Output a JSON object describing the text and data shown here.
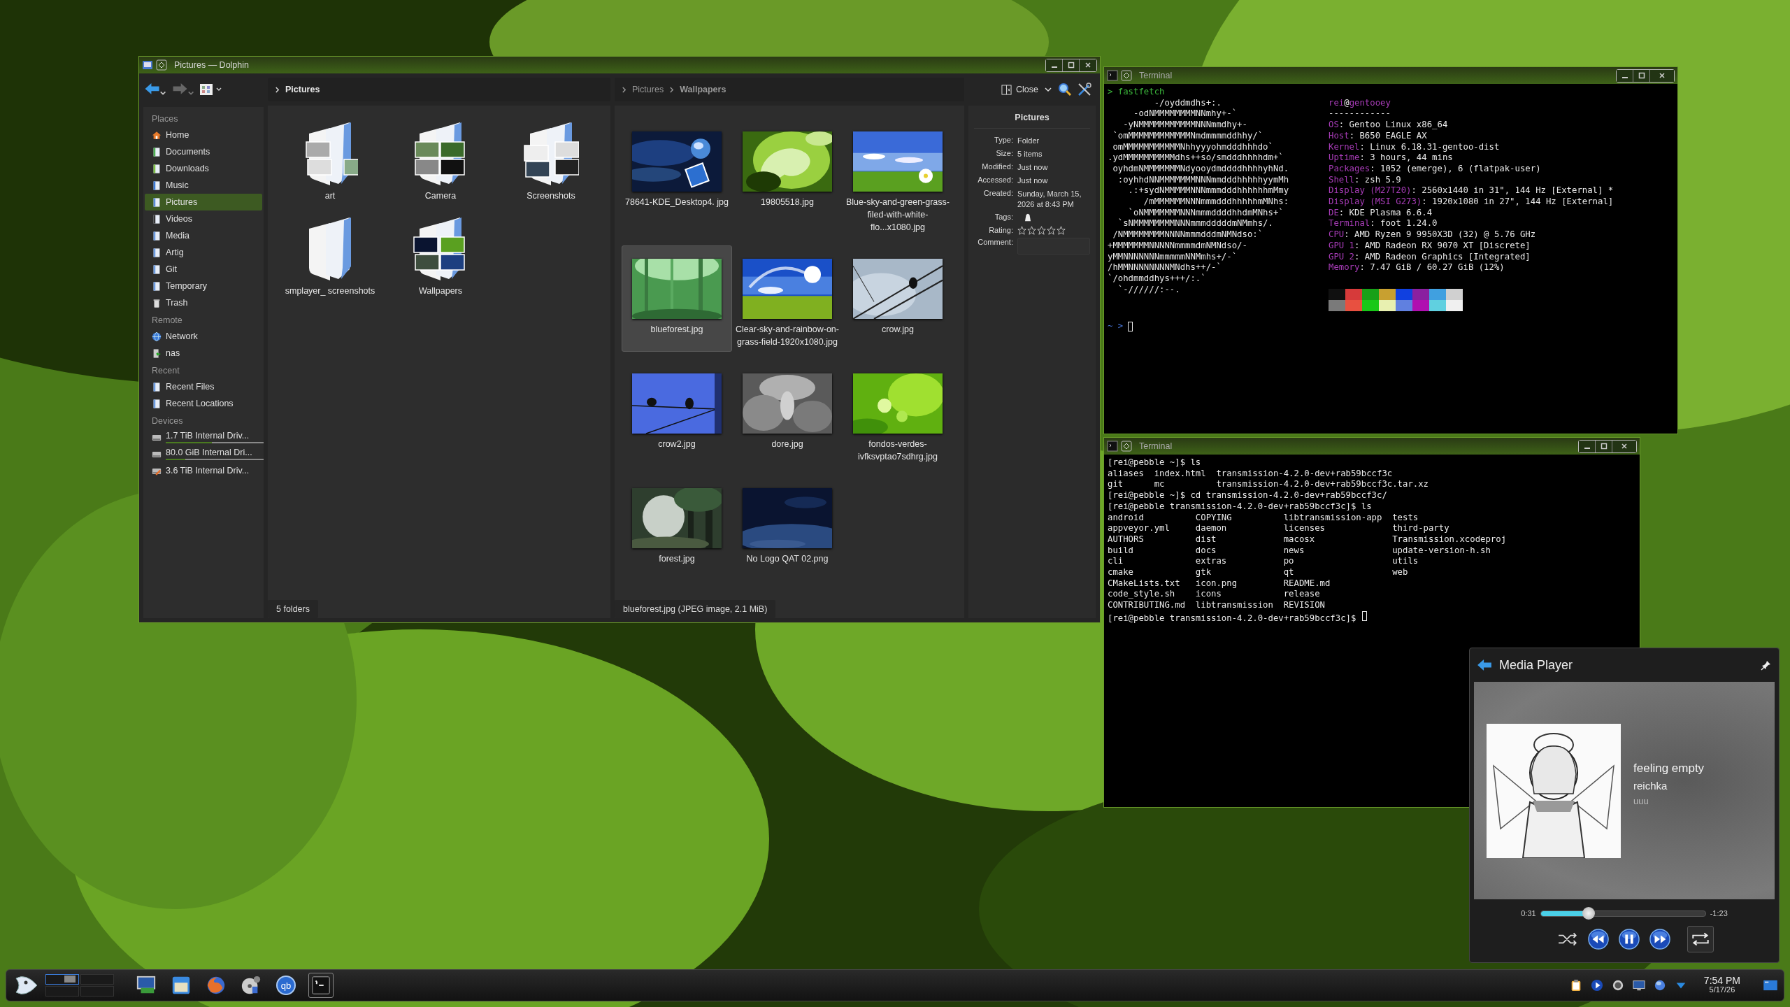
{
  "dolphin": {
    "title": "Pictures — Dolphin",
    "places": [
      {
        "heading": "Places",
        "items": [
          {
            "label": "Home",
            "kind": "home",
            "selected": false
          },
          {
            "label": "Documents",
            "kind": "documents",
            "selected": false
          },
          {
            "label": "Downloads",
            "kind": "downloads",
            "selected": false
          },
          {
            "label": "Music",
            "kind": "music",
            "selected": false
          },
          {
            "label": "Pictures",
            "kind": "pictures",
            "selected": true
          },
          {
            "label": "Videos",
            "kind": "videos",
            "selected": false
          },
          {
            "label": "Media",
            "kind": "folder",
            "selected": false
          },
          {
            "label": "Artig",
            "kind": "folder",
            "selected": false
          },
          {
            "label": "Git",
            "kind": "folder",
            "selected": false
          },
          {
            "label": "Temporary",
            "kind": "folder",
            "selected": false
          },
          {
            "label": "Trash",
            "kind": "trash",
            "selected": false
          }
        ]
      },
      {
        "heading": "Remote",
        "items": [
          {
            "label": "Network",
            "kind": "network",
            "selected": false
          },
          {
            "label": "nas",
            "kind": "nas",
            "selected": false
          }
        ]
      },
      {
        "heading": "Recent",
        "items": [
          {
            "label": "Recent Files",
            "kind": "folder",
            "selected": false
          },
          {
            "label": "Recent Locations",
            "kind": "folder",
            "selected": false
          }
        ]
      },
      {
        "heading": "Devices",
        "items": [
          {
            "label": "1.7 TiB Internal Driv...",
            "kind": "drive",
            "selected": false,
            "level": 0.47
          },
          {
            "label": "80.0 GiB Internal Dri...",
            "kind": "drive",
            "selected": false,
            "level": 0.2
          },
          {
            "label": "3.6 TiB Internal Driv...",
            "kind": "drive-alt",
            "selected": false
          }
        ]
      }
    ],
    "left_view": {
      "breadcrumb": [
        "Pictures"
      ],
      "items": [
        {
          "label": "art"
        },
        {
          "label": "Camera"
        },
        {
          "label": "Screenshots"
        },
        {
          "label": "smplayer_ screenshots"
        },
        {
          "label": "Wallpapers"
        }
      ],
      "status": "5 folders"
    },
    "right_view": {
      "breadcrumb": [
        "Pictures",
        "Wallpapers"
      ],
      "items": [
        {
          "label": "78641-KDE_Desktop4. jpg",
          "selected": false
        },
        {
          "label": "19805518.jpg",
          "selected": false
        },
        {
          "label": "Blue-sky-and-green-grass-filed-with-white-flo...x1080.jpg",
          "selected": false
        },
        {
          "label": "blueforest.jpg",
          "selected": true
        },
        {
          "label": "Clear-sky-and-rainbow-on-grass-field-1920x1080.jpg",
          "selected": false
        },
        {
          "label": "crow.jpg",
          "selected": false
        },
        {
          "label": "crow2.jpg",
          "selected": false
        },
        {
          "label": "dore.jpg",
          "selected": false
        },
        {
          "label": "fondos-verdes-ivfksvptao7sdhrg.jpg",
          "selected": false
        },
        {
          "label": "forest.jpg",
          "selected": false
        },
        {
          "label": "No Logo QAT 02.png",
          "selected": false
        }
      ],
      "status": "blueforest.jpg (JPEG image, 2.1 MiB)"
    },
    "close_button": "Close",
    "info": {
      "title": "Pictures",
      "fields": [
        {
          "key": "Type:",
          "value": "Folder"
        },
        {
          "key": "Size:",
          "value": "5 items"
        },
        {
          "key": "Modified:",
          "value": "Just now"
        },
        {
          "key": "Accessed:",
          "value": "Just now"
        },
        {
          "key": "Created:",
          "value": "Sunday, March 15, 2026 at 8:43 PM"
        }
      ],
      "tags_label": "Tags:",
      "rating_label": "Rating:",
      "stars": 0,
      "comment_label": "Comment:"
    }
  },
  "terminal_1": {
    "title": "Terminal",
    "command": "> fastfetch",
    "logo": [
      "         -/oyddmdhs+:.",
      "     -odNMMMMMMMMNNmhy+-`",
      "   -yNMMMMMMMMMMMNNNmmdhy+-",
      " `omMMMMMMMMMMMMNmdmmmmddhhy/`",
      " omMMMMMMMMMMMNhhyyyohmdddhhhdo`",
      ".ydMMMMMMMMMMdhs++so/smdddhhhhdm+`",
      " oyhdmNMMMMMMMNdyooydmddddhhhhyhNd.",
      "  :oyhhdNNMMMMMMMNNNmmdddhhhhhyymMh",
      "    .:+sydNMMMMMNNNmmmdddhhhhhhmMmy",
      "       /mMMMMMMNNNmmmdddhhhhhmMNhs:",
      "    `oNMMMMMMMNNNmmmddddhhdmMNhs+`",
      "  `sNMMMMMMMMNNNmmmdddddmNMmhs/.",
      " /NMMMMMMMMNNNNmmmdddmNMNdso:`",
      "+MMMMMMMNNNNNmmmmdmNMNdso/-",
      "yMMNNNNNNNmmmmmNNMmhs+/-`",
      "/hMMNNNNNNNNMNdhs++/-`",
      "`/ohdmmddhys+++/:.`",
      "  `-//////:--."
    ],
    "user": "rei",
    "separator": "@",
    "host": "gentooey",
    "rule": "------------",
    "fields": [
      {
        "key": "OS",
        "value": ": Gentoo Linux x86_64"
      },
      {
        "key": "Host",
        "value": ": B650 EAGLE AX"
      },
      {
        "key": "Kernel",
        "value": ": Linux 6.18.31-gentoo-dist"
      },
      {
        "key": "Uptime",
        "value": ": 3 hours, 44 mins"
      },
      {
        "key": "Packages",
        "value": ": 1052 (emerge), 6 (flatpak-user)"
      },
      {
        "key": "Shell",
        "value": ": zsh 5.9"
      },
      {
        "key": "Display (M27T20)",
        "value": ": 2560x1440 in 31\", 144 Hz [External] *"
      },
      {
        "key": "Display (MSI G273)",
        "value": ": 1920x1080 in 27\", 144 Hz [External]"
      },
      {
        "key": "DE",
        "value": ": KDE Plasma 6.6.4"
      },
      {
        "key": "Terminal",
        "value": ": foot 1.24.0"
      },
      {
        "key": "CPU",
        "value": ": AMD Ryzen 9 9950X3D (32) @ 5.76 GHz"
      },
      {
        "key": "GPU 1",
        "value": ": AMD Radeon RX 9070 XT [Discrete]"
      },
      {
        "key": "GPU 2",
        "value": ": AMD Radeon Graphics [Integrated]"
      },
      {
        "key": "Memory",
        "value": ": 7.47 GiB / 60.27 GiB (12%)"
      }
    ],
    "palette": [
      {
        "color": "#101010"
      },
      {
        "color": "#d63a3a"
      },
      {
        "color": "#18a018"
      },
      {
        "color": "#c8a030"
      },
      {
        "color": "#1040e0"
      },
      {
        "color": "#8a20a0"
      },
      {
        "color": "#40a0e0"
      },
      {
        "color": "#d0d0d0"
      },
      {
        "color": "#7a7a7a"
      },
      {
        "color": "#e85040"
      },
      {
        "color": "#18c818"
      },
      {
        "color": "#e8f0b0"
      },
      {
        "color": "#6080e0"
      },
      {
        "color": "#b010b0"
      },
      {
        "color": "#60d0e0"
      },
      {
        "color": "#f0f0f0"
      }
    ],
    "prompt": "~ >"
  },
  "terminal_2": {
    "title": "Terminal",
    "lines": [
      "[rei@pebble ~]$ ls",
      "aliases  index.html  transmission-4.2.0-dev+rab59bccf3c",
      "git      mc          transmission-4.2.0-dev+rab59bccf3c.tar.xz",
      "[rei@pebble ~]$ cd transmission-4.2.0-dev+rab59bccf3c/",
      "[rei@pebble transmission-4.2.0-dev+rab59bccf3c]$ ls",
      "android          COPYING          libtransmission-app  tests",
      "appveyor.yml     daemon           licenses             third-party",
      "AUTHORS          dist             macosx               Transmission.xcodeproj",
      "build            docs             news                 update-version-h.sh",
      "cli              extras           po                   utils",
      "cmake            gtk              qt                   web",
      "CMakeLists.txt   icon.png         README.md",
      "code_style.sh    icons            release",
      "CONTRIBUTING.md  libtransmission  REVISION",
      "[rei@pebble transmission-4.2.0-dev+rab59bccf3c]$ "
    ]
  },
  "media_player": {
    "title": "Media Player",
    "track": "feeling empty",
    "artist": "reichka",
    "album": "uuu",
    "elapsed": "0:31",
    "remaining": "-1:23",
    "level": 0.29,
    "controls": [
      {
        "kind": "shuffle",
        "selected": false
      },
      {
        "kind": "previous",
        "selected": false
      },
      {
        "kind": "pause",
        "selected": false
      },
      {
        "kind": "next",
        "selected": false
      },
      {
        "kind": "repeat",
        "selected": true
      }
    ]
  },
  "taskbar": {
    "pager": [
      {
        "selected": true
      },
      {
        "selected": false
      },
      {
        "selected": false
      },
      {
        "selected": false
      }
    ],
    "launchers": [
      {
        "kind": "monitor",
        "selected": false
      },
      {
        "kind": "files",
        "selected": false
      },
      {
        "kind": "browser",
        "selected": false
      },
      {
        "kind": "music",
        "selected": false
      },
      {
        "kind": "torrent",
        "label": "qb",
        "selected": false
      },
      {
        "kind": "terminal",
        "selected": true
      }
    ],
    "tray": [
      {
        "kind": "clipboard"
      },
      {
        "kind": "play"
      },
      {
        "kind": "speaker"
      },
      {
        "kind": "display"
      },
      {
        "kind": "network"
      },
      {
        "kind": "expand"
      }
    ],
    "time": "7:54 PM",
    "date": "5/17/26"
  }
}
